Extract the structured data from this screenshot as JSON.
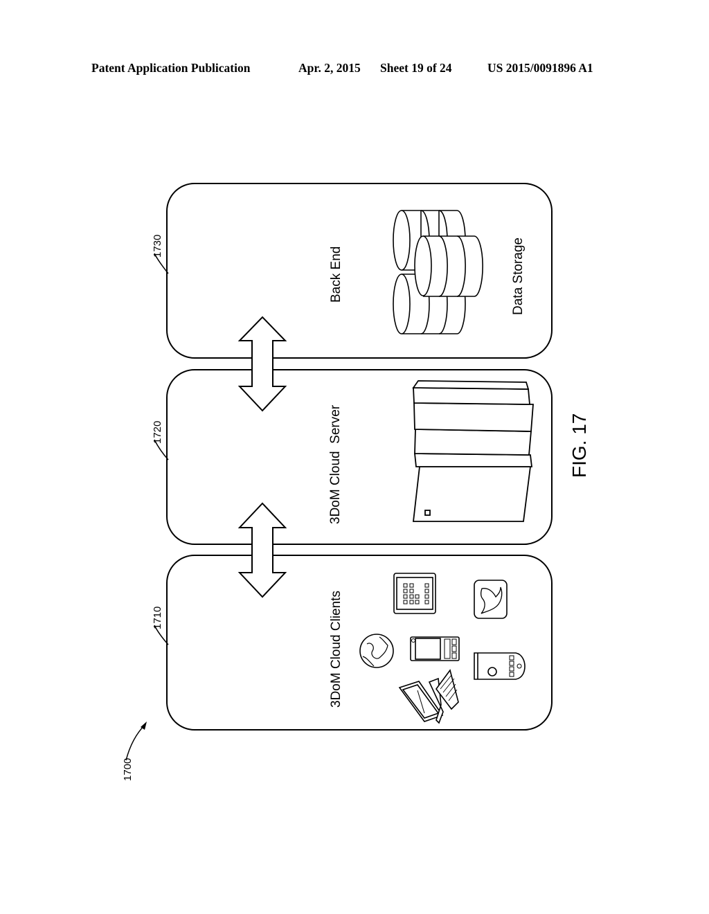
{
  "header": {
    "publication": "Patent Application Publication",
    "date": "Apr. 2, 2015",
    "sheet": "Sheet 19 of 24",
    "number": "US 2015/0091896 A1"
  },
  "figure": {
    "label": "FIG. 17",
    "ref": "1700",
    "panels": [
      {
        "ref": "1710",
        "title": "3DoM Cloud Clients",
        "icons": [
          "tablet-icon",
          "bird-app-icon",
          "globe-icon",
          "smartphone-icon",
          "mobile-phone-icon",
          "desktop-computer-icon"
        ]
      },
      {
        "ref": "1720",
        "title": "3DoM Cloud  Server",
        "icons": [
          "server-rack-icon"
        ]
      },
      {
        "ref": "1730",
        "title": "Back End",
        "caption": "Data Storage",
        "icons": [
          "database-icon"
        ]
      }
    ],
    "connectors": [
      "bidirectional-arrow-clients-server",
      "bidirectional-arrow-server-backend"
    ]
  }
}
